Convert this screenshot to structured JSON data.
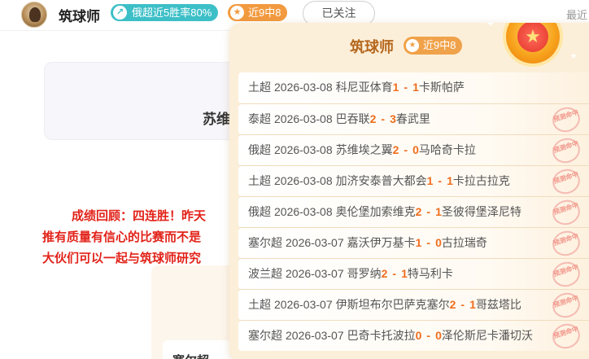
{
  "header": {
    "author_name": "筑球师",
    "rate_badge": "俄超近5胜率80%",
    "streak_badge": "近9中8",
    "follow_label": "已关注",
    "recent_label": "最近"
  },
  "article": {
    "card_title": "苏维",
    "recap_lines": [
      "成绩回顾：四连胜！昨天",
      "推有质量有信心的比赛而不是",
      "大伙们可以一起与筑球师研究"
    ],
    "bottom_text": "塞尔超"
  },
  "popup": {
    "title": "筑球师",
    "badge": "近9中8",
    "stamp_text": "预测命中",
    "rows": [
      {
        "league": "土超",
        "date": "2026-03-08",
        "home": "科尼亚体育",
        "home_score": "1",
        "away_score": "1",
        "away": "卡斯帕萨",
        "hit": false
      },
      {
        "league": "泰超",
        "date": "2026-03-08",
        "home": "巴吞联",
        "home_score": "2",
        "away_score": "3",
        "away": "春武里",
        "hit": true
      },
      {
        "league": "俄超",
        "date": "2026-03-08",
        "home": "苏维埃之翼",
        "home_score": "2",
        "away_score": "0",
        "away": "马哈奇卡拉",
        "hit": true
      },
      {
        "league": "土超",
        "date": "2026-03-08",
        "home": "加济安泰普大都会",
        "home_score": "1",
        "away_score": "1",
        "away": "卡拉古拉克",
        "hit": true
      },
      {
        "league": "俄超",
        "date": "2026-03-08",
        "home": "奥伦堡加索维克",
        "home_score": "2",
        "away_score": "1",
        "away": "圣彼得堡泽尼特",
        "hit": true
      },
      {
        "league": "塞尔超",
        "date": "2026-03-07",
        "home": "嘉沃伊万基卡",
        "home_score": "1",
        "away_score": "0",
        "away": "古拉瑞奇",
        "hit": true
      },
      {
        "league": "波兰超",
        "date": "2026-03-07",
        "home": "哥罗纳",
        "home_score": "2",
        "away_score": "1",
        "away": "特马利卡",
        "hit": true
      },
      {
        "league": "土超",
        "date": "2026-03-07",
        "home": "伊斯坦布尔巴萨克塞尔",
        "home_score": "2",
        "away_score": "1",
        "away": "哥兹塔比",
        "hit": true
      },
      {
        "league": "塞尔超",
        "date": "2026-03-07",
        "home": "巴奇卡托波拉",
        "home_score": "0",
        "away_score": "0",
        "away": "泽伦斯尼卡潘切沃",
        "hit": true
      }
    ]
  }
}
